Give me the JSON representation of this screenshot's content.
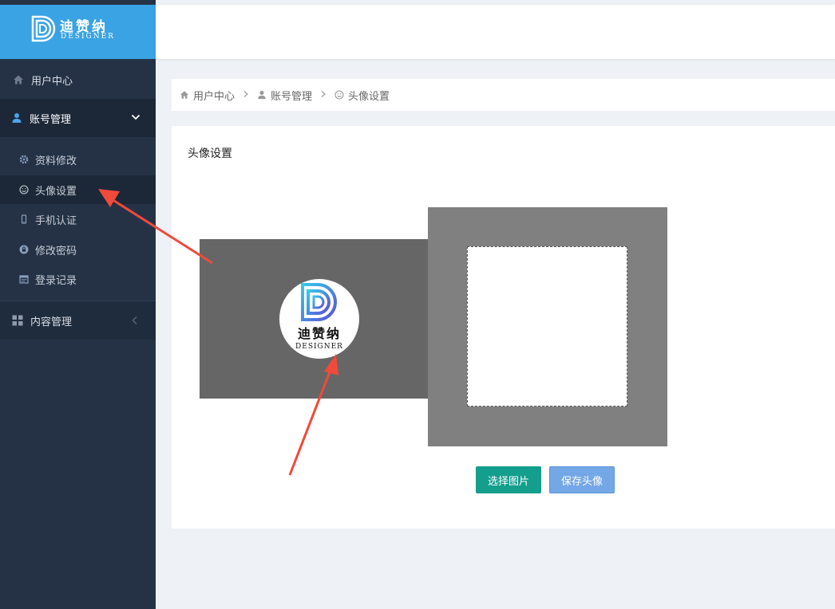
{
  "brand": {
    "name": "迪赞纳",
    "subtitle": "DESIGNER"
  },
  "sidebar": {
    "items": [
      {
        "label": "用户中心",
        "icon": "home-icon"
      },
      {
        "label": "账号管理",
        "icon": "user-icon",
        "expanded": true
      },
      {
        "label": "内容管理",
        "icon": "grid-icon",
        "expanded": false
      }
    ],
    "sub_items": [
      {
        "label": "资料修改",
        "icon": "gear-icon"
      },
      {
        "label": "头像设置",
        "icon": "smile-icon",
        "active": true
      },
      {
        "label": "手机认证",
        "icon": "mobile-icon"
      },
      {
        "label": "修改密码",
        "icon": "lock-icon"
      },
      {
        "label": "登录记录",
        "icon": "calendar-icon"
      }
    ]
  },
  "breadcrumb": [
    {
      "label": "用户中心",
      "icon": "home-icon"
    },
    {
      "label": "账号管理",
      "icon": "user-icon"
    },
    {
      "label": "头像设置",
      "icon": "smile-icon"
    }
  ],
  "main": {
    "title": "头像设置",
    "preview": {
      "name": "迪赞纳",
      "subtitle": "DESIGNER"
    },
    "buttons": {
      "select": "选择图片",
      "save": "保存头像"
    }
  },
  "colors": {
    "sidebar_bg": "#253246",
    "logo_bar": "#3aa3e3",
    "select_button": "#149e8c",
    "save_button": "#74a7e6",
    "annotation_arrow": "#f04a3a"
  }
}
